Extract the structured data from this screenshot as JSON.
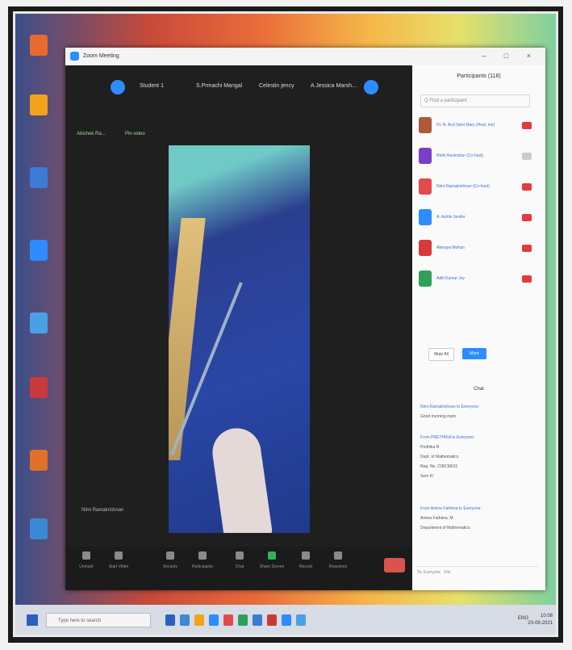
{
  "window": {
    "title": "Zoom Meeting",
    "controls": "– □ ×"
  },
  "gallery": {
    "names": [
      "Student 1",
      "S.Prmachi Mangal",
      "Celestin jency",
      "A Jessica Marsh..."
    ],
    "small_labels": [
      "Abishek Ra...",
      "Pin video"
    ],
    "speaker_tag": "Nimi Ramakrishnan"
  },
  "toolbar": {
    "items": [
      "Unmute",
      "Start Video",
      "Security",
      "Participants",
      "Chat",
      "Share Screen",
      "Record",
      "Reactions"
    ],
    "end_label": "End"
  },
  "participants": {
    "title": "Participants (118)",
    "search_placeholder": "Q Find a participant",
    "list": [
      {
        "name": "Dr. N. Arul Selvi Mary (Host, me)",
        "color": "#b0583a",
        "mic": "on"
      },
      {
        "name": "Rethi Ravindran (Co-host)",
        "color": "#7a3ec8",
        "mic": "off"
      },
      {
        "name": "Nimi Ramakrishnan (Co-host)",
        "color": "#e24b4b",
        "mic": "on"
      },
      {
        "name": "A. Ashlin Jenifer",
        "color": "#2d8cff",
        "mic": "on"
      },
      {
        "name": "Abinaya Mohan",
        "color": "#d63a3a",
        "mic": "on"
      },
      {
        "name": "Aditi Kumar Joy",
        "color": "#2fa05a",
        "mic": "on"
      }
    ],
    "mute_label": "Mute All",
    "more_label": "More"
  },
  "chat": {
    "title": "Chat",
    "lines": [
      {
        "text": "Nimi Ramakrishnan to Everyone:",
        "from": true
      },
      {
        "text": "Good morning mam",
        "from": false
      },
      {
        "text": "From PRETHIKA to Everyone:",
        "from": true
      },
      {
        "text": "Prethika R",
        "from": false
      },
      {
        "text": "Dept. of Mathematics",
        "from": false
      },
      {
        "text": "Reg. No. 21BCM015",
        "from": false
      },
      {
        "text": "Sem III",
        "from": false
      },
      {
        "text": "From Amina Fathima to Everyone:",
        "from": true
      },
      {
        "text": "Amina Fathima. M",
        "from": false
      },
      {
        "text": "Department of Mathematics",
        "from": false
      }
    ],
    "input_label": "To: Everyone",
    "file_label": "File"
  },
  "taskbar": {
    "search_placeholder": "Type here to search",
    "time": "10:08",
    "date": "20-09-2021",
    "tray": "ENG"
  },
  "colors": {
    "zoom_blue": "#2d8cff",
    "end_red": "#d9534f"
  }
}
